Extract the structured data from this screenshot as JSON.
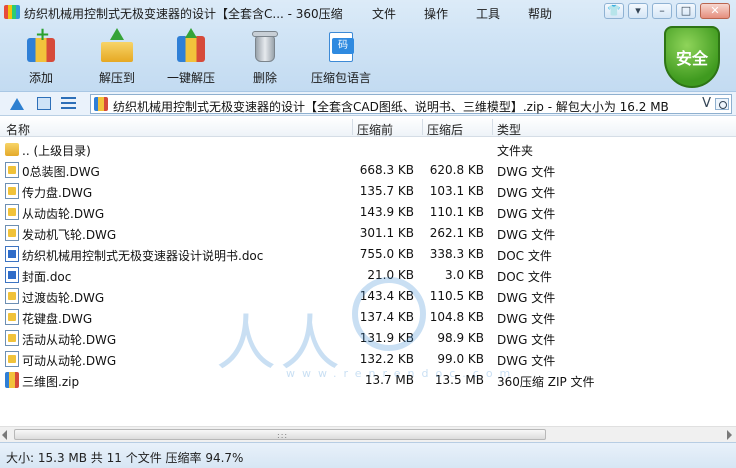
{
  "window": {
    "title": "纺织机械用控制式无极变速器的设计【全套含C... - 360压缩",
    "menus": [
      "文件",
      "操作",
      "工具",
      "帮助"
    ]
  },
  "toolbar": {
    "items": [
      {
        "label": "添加",
        "icon": "add-archive-icon"
      },
      {
        "label": "解压到",
        "icon": "extract-to-icon"
      },
      {
        "label": "一键解压",
        "icon": "one-click-extract-icon"
      },
      {
        "label": "删除",
        "icon": "trash-icon"
      },
      {
        "label": "压缩包语言",
        "icon": "archive-language-icon"
      }
    ],
    "language_code_glyph": "码",
    "security_badge": "安全"
  },
  "address": {
    "path": "纺织机械用控制式无极变速器的设计【全套含CAD图纸、说明书、三维模型】.zip - 解包大小为 16.2 MB",
    "dropdown_glyph": "V"
  },
  "columns": {
    "name": "名称",
    "compressed_before": "压缩前",
    "compressed_after": "压缩后",
    "type": "类型"
  },
  "files": [
    {
      "name": ".. (上级目录)",
      "before": "",
      "after": "",
      "type": "文件夹",
      "kind": "folder"
    },
    {
      "name": "0总装图.DWG",
      "before": "668.3 KB",
      "after": "620.8 KB",
      "type": "DWG 文件",
      "kind": "dwg"
    },
    {
      "name": "传力盘.DWG",
      "before": "135.7 KB",
      "after": "103.1 KB",
      "type": "DWG 文件",
      "kind": "dwg"
    },
    {
      "name": "从动齿轮.DWG",
      "before": "143.9 KB",
      "after": "110.1 KB",
      "type": "DWG 文件",
      "kind": "dwg"
    },
    {
      "name": "发动机飞轮.DWG",
      "before": "301.1 KB",
      "after": "262.1 KB",
      "type": "DWG 文件",
      "kind": "dwg"
    },
    {
      "name": "纺织机械用控制式无极变速器设计说明书.doc",
      "before": "755.0 KB",
      "after": "338.3 KB",
      "type": "DOC 文件",
      "kind": "doc"
    },
    {
      "name": "封面.doc",
      "before": "21.0 KB",
      "after": "3.0 KB",
      "type": "DOC 文件",
      "kind": "doc"
    },
    {
      "name": "过渡齿轮.DWG",
      "before": "143.4 KB",
      "after": "110.5 KB",
      "type": "DWG 文件",
      "kind": "dwg"
    },
    {
      "name": "花键盘.DWG",
      "before": "137.4 KB",
      "after": "104.8 KB",
      "type": "DWG 文件",
      "kind": "dwg"
    },
    {
      "name": "活动从动轮.DWG",
      "before": "131.9 KB",
      "after": "98.9 KB",
      "type": "DWG 文件",
      "kind": "dwg"
    },
    {
      "name": "可动从动轮.DWG",
      "before": "132.2 KB",
      "after": "99.0 KB",
      "type": "DWG 文件",
      "kind": "dwg"
    },
    {
      "name": "三维图.zip",
      "before": "13.7 MB",
      "after": "13.5 MB",
      "type": "360压缩 ZIP 文件",
      "kind": "zip"
    }
  ],
  "watermark": {
    "text": "人人",
    "url": "www.renrendoc.com"
  },
  "status": {
    "text": "大小: 15.3 MB 共 11 个文件 压缩率 94.7%"
  }
}
